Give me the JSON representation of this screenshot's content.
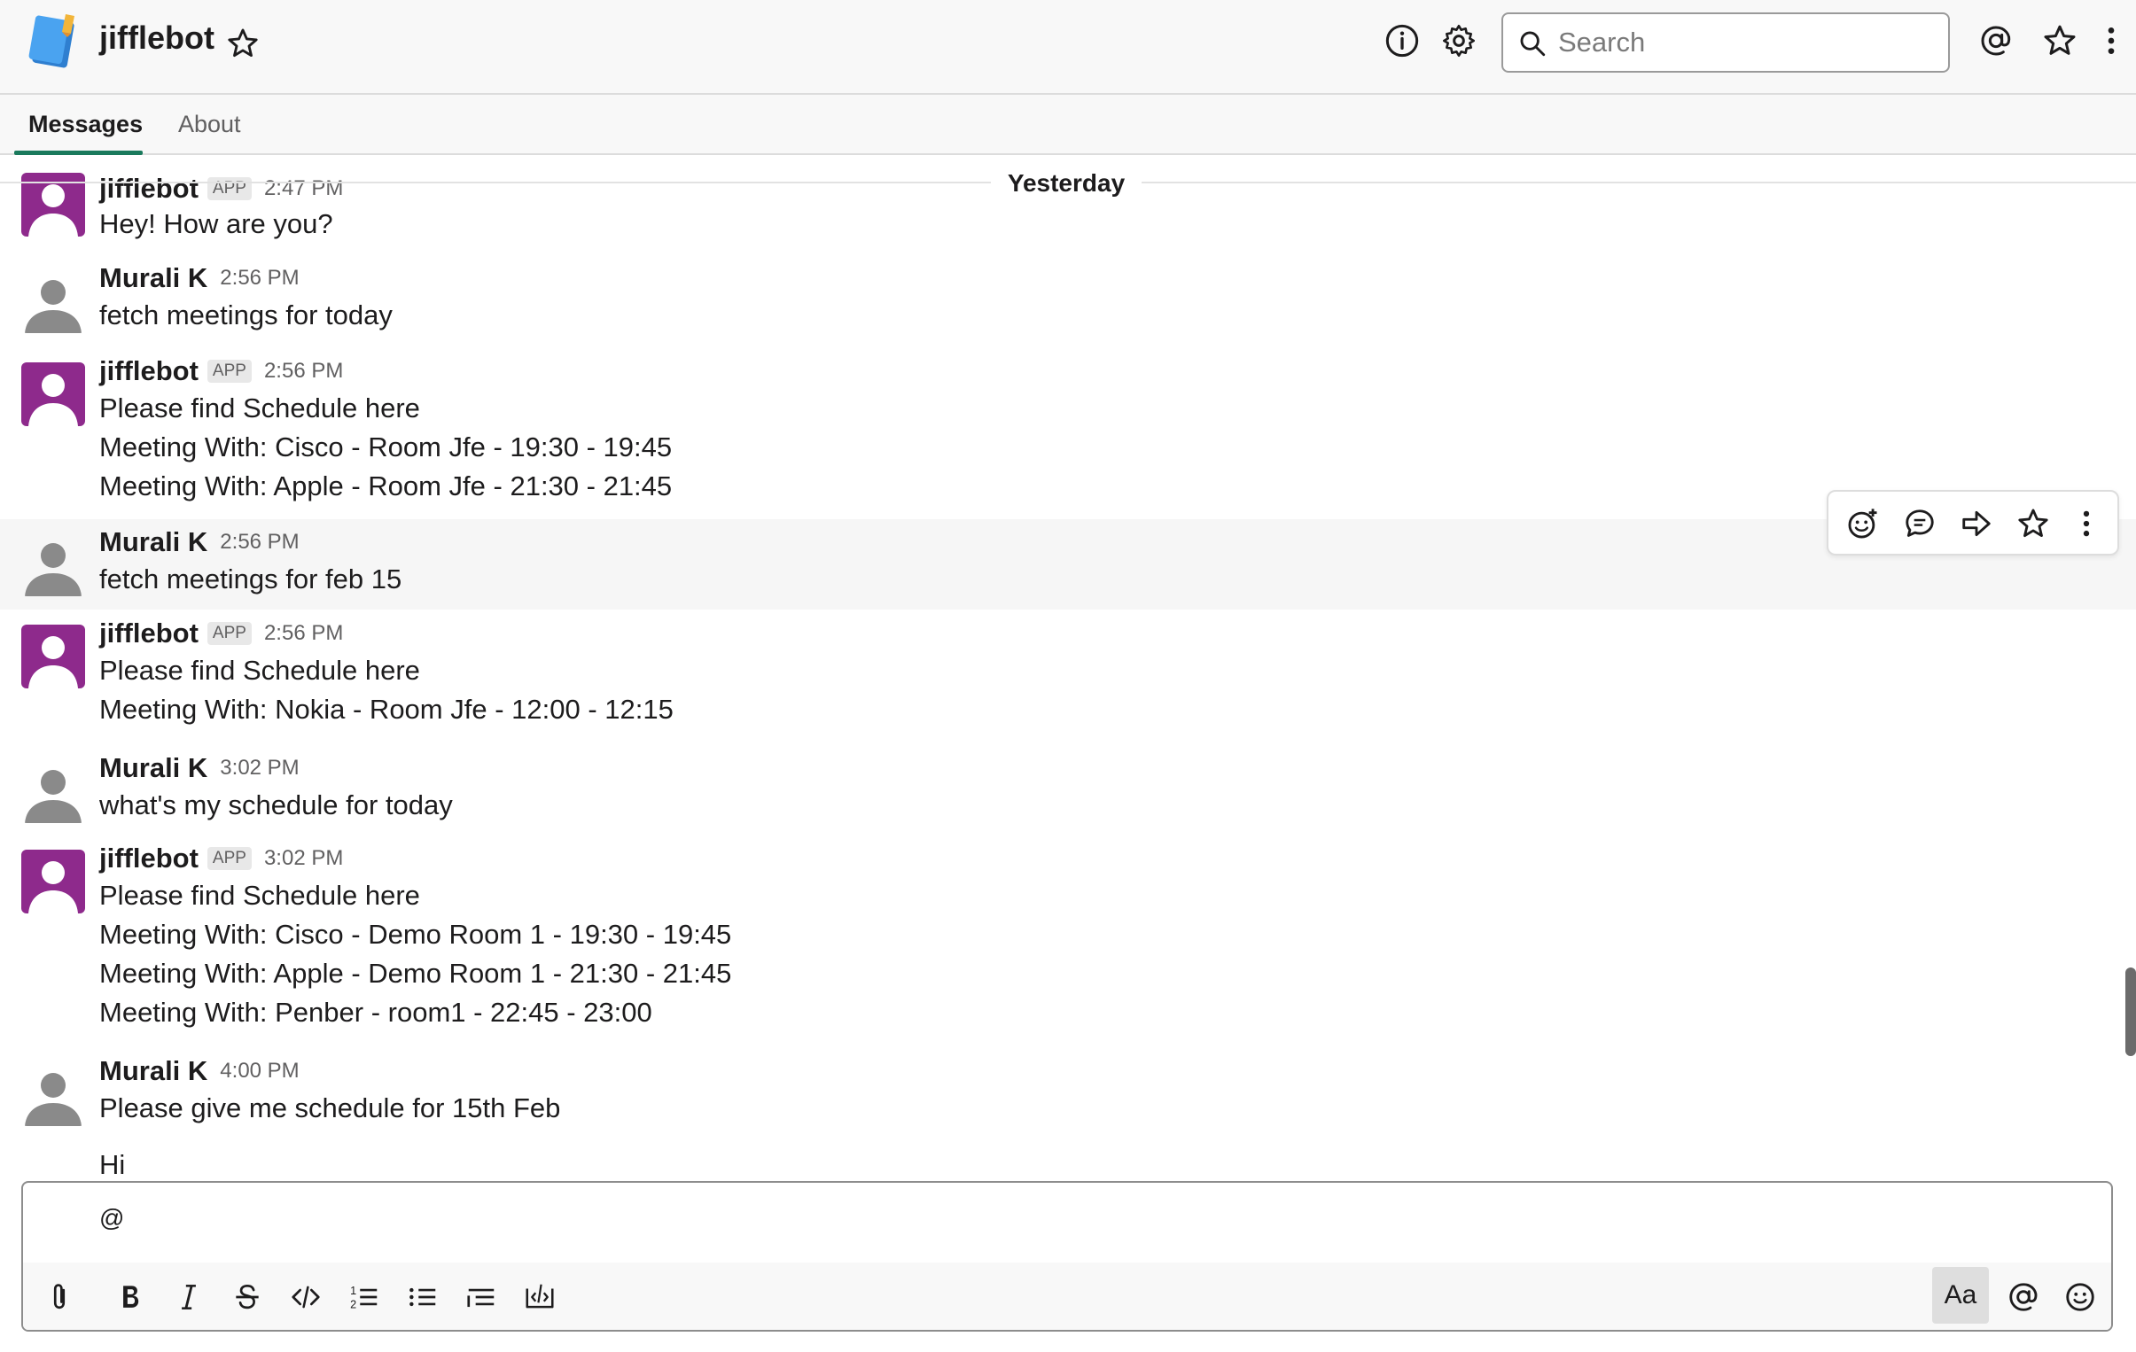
{
  "header": {
    "title": "jifflebot",
    "search_placeholder": "Search",
    "icons": [
      "info-icon",
      "gear-icon",
      "search-icon",
      "at-icon",
      "star-icon",
      "more-vertical-icon"
    ]
  },
  "tabs": [
    {
      "label": "Messages",
      "active": true
    },
    {
      "label": "About",
      "active": false
    }
  ],
  "day_divider": "Yesterday",
  "messages": [
    {
      "sender": "jifflebot",
      "badge": "APP",
      "time": "2:47 PM",
      "lines": [
        "Hey! How are you?"
      ]
    },
    {
      "sender": "Murali K",
      "badge": "",
      "time": "2:56 PM",
      "lines": [
        "fetch meetings for today"
      ]
    },
    {
      "sender": "jifflebot",
      "badge": "APP",
      "time": "2:56 PM",
      "lines": [
        "Please find Schedule here",
        "Meeting With: Cisco - Room Jfe - 19:30 - 19:45",
        "Meeting With: Apple - Room Jfe - 21:30 - 21:45"
      ]
    },
    {
      "sender": "Murali K",
      "badge": "",
      "time": "2:56 PM",
      "lines": [
        "fetch meetings for feb 15"
      ]
    },
    {
      "sender": "jifflebot",
      "badge": "APP",
      "time": "2:56 PM",
      "lines": [
        "Please find Schedule here",
        "Meeting With: Nokia - Room Jfe - 12:00 - 12:15"
      ]
    },
    {
      "sender": "Murali K",
      "badge": "",
      "time": "3:02 PM",
      "lines": [
        "what's my schedule for today"
      ]
    },
    {
      "sender": "jifflebot",
      "badge": "APP",
      "time": "3:02 PM",
      "lines": [
        "Please find Schedule here",
        "Meeting With: Cisco - Demo Room 1 - 19:30 - 19:45",
        "Meeting With: Apple - Demo Room 1 - 21:30 - 21:45",
        "Meeting With: Penber - room1 - 22:45 - 23:00"
      ]
    },
    {
      "sender": "Murali K",
      "badge": "",
      "time": "4:00 PM",
      "lines": [
        "Please give me schedule for 15th Feb",
        "Hi"
      ]
    }
  ],
  "composer": {
    "value": "@",
    "format_button": "Aa"
  },
  "colors": {
    "accent_tab": "#1a7a5c",
    "bot_avatar": "#8e2a8c",
    "user_avatar": "#8a8a8a"
  }
}
